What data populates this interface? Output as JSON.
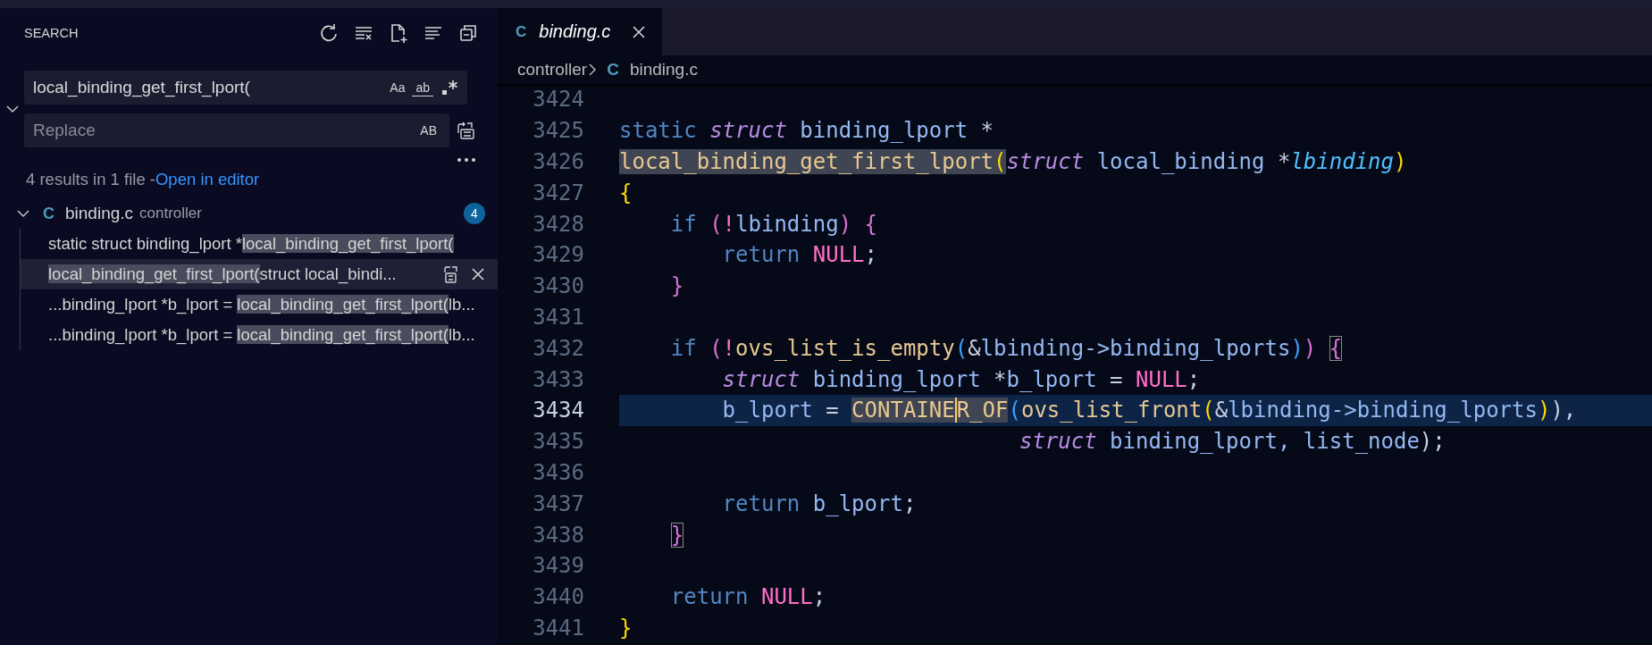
{
  "sidebar": {
    "title": "SEARCH",
    "search": {
      "value": "local_binding_get_first_lport(",
      "case_label": "Aa",
      "word_label": "ab"
    },
    "replace": {
      "expanded": true,
      "placeholder": "Replace",
      "preserve_case_label": "AB"
    },
    "summary": {
      "text": "4 results in 1 file - ",
      "link": "Open in editor"
    },
    "file": {
      "expanded": true,
      "icon_letter": "C",
      "name": "binding.c",
      "folder": "controller",
      "count": "4"
    },
    "results": [
      {
        "before": "static struct binding_lport *",
        "match": "local_binding_get_first_lport(",
        "selected": false
      },
      {
        "match": "local_binding_get_first_lport(",
        "after": "struct local_bindi...",
        "selected": true
      },
      {
        "before": "...binding_lport *b_lport = ",
        "match": "local_binding_get_first_lport(",
        "after": "lb...",
        "selected": false
      },
      {
        "before": "...binding_lport *b_lport = ",
        "match": "local_binding_get_first_lport(",
        "after": "lb...",
        "selected": false
      }
    ]
  },
  "editor": {
    "tab": {
      "icon_letter": "C",
      "label": "binding.c",
      "selected": true
    },
    "breadcrumb": {
      "folder": "controller",
      "icon_letter": "C",
      "file": "binding.c"
    },
    "lines": [
      {
        "number": "3424",
        "current": false
      },
      {
        "number": "3425",
        "current": false,
        "tokens": [
          {
            "text": "static",
            "kind": "keyword"
          },
          {
            "text": " struct",
            "kind": "storage"
          },
          {
            "text": " binding_lport ",
            "kind": "type"
          },
          {
            "text": "*",
            "kind": "op"
          }
        ]
      },
      {
        "number": "3426",
        "current": false,
        "tokens": [
          {
            "text": "local_binding_get_first_lport",
            "kind": "function",
            "highlight": true
          },
          {
            "text": "(",
            "kind": "bracket1",
            "highlight": true
          },
          {
            "text": "struct",
            "kind": "storage"
          },
          {
            "text": " local_binding ",
            "kind": "type"
          },
          {
            "text": "*",
            "kind": "op"
          },
          {
            "text": "lbinding",
            "kind": "param"
          },
          {
            "text": ")",
            "kind": "bracket1"
          }
        ]
      },
      {
        "number": "3427",
        "current": false,
        "tokens": [
          {
            "text": "{",
            "kind": "bracket1"
          }
        ]
      },
      {
        "number": "3428",
        "current": false,
        "tokens": [
          {
            "text": "    if",
            "kind": "keyword"
          },
          {
            "text": " (",
            "kind": "bracket2"
          },
          {
            "text": "!",
            "kind": "null"
          },
          {
            "text": "lbinding",
            "kind": "type"
          },
          {
            "text": ")",
            "kind": "bracket2"
          },
          {
            "text": " {",
            "kind": "bracket2"
          }
        ]
      },
      {
        "number": "3429",
        "current": false,
        "tokens": [
          {
            "text": "        return",
            "kind": "keyword"
          },
          {
            "text": " NULL",
            "kind": "null"
          },
          {
            "text": ";",
            "kind": "op"
          }
        ]
      },
      {
        "number": "3430",
        "current": false,
        "tokens": [
          {
            "text": "    }",
            "kind": "bracket2"
          }
        ]
      },
      {
        "number": "3431",
        "current": false
      },
      {
        "number": "3432",
        "current": false,
        "tokens": [
          {
            "text": "    if",
            "kind": "keyword"
          },
          {
            "text": " (",
            "kind": "bracket2"
          },
          {
            "text": "!",
            "kind": "null"
          },
          {
            "text": "ovs_list_is_empty",
            "kind": "function"
          },
          {
            "text": "(",
            "kind": "bracket3"
          },
          {
            "text": "&",
            "kind": "op"
          },
          {
            "text": "lbinding->binding_lports",
            "kind": "type"
          },
          {
            "text": ")",
            "kind": "bracket3"
          },
          {
            "text": ") ",
            "kind": "bracket2"
          },
          {
            "text": "{",
            "kind": "bracket2",
            "boxed": true
          }
        ]
      },
      {
        "number": "3433",
        "current": false,
        "tokens": [
          {
            "text": "        struct",
            "kind": "storage"
          },
          {
            "text": " binding_lport ",
            "kind": "type"
          },
          {
            "text": "*",
            "kind": "op"
          },
          {
            "text": "b_lport ",
            "kind": "type"
          },
          {
            "text": "=",
            "kind": "op"
          },
          {
            "text": " NULL",
            "kind": "null"
          },
          {
            "text": ";",
            "kind": "op"
          }
        ]
      },
      {
        "number": "3434",
        "current": true,
        "tokens": [
          {
            "text": "        b_lport ",
            "kind": "type"
          },
          {
            "text": "= ",
            "kind": "op"
          },
          {
            "text": "CONTAINE",
            "kind": "function",
            "highlight": true
          },
          {
            "text": "R_OF",
            "kind": "function",
            "highlight": true,
            "cursor": true
          },
          {
            "text": "(",
            "kind": "bracket3"
          },
          {
            "text": "ovs_list_front",
            "kind": "function"
          },
          {
            "text": "(",
            "kind": "bracket1"
          },
          {
            "text": "&",
            "kind": "op"
          },
          {
            "text": "lbinding->binding_lports",
            "kind": "type"
          },
          {
            "text": ")",
            "kind": "bracket1"
          },
          {
            "text": "),",
            "kind": "op"
          }
        ]
      },
      {
        "number": "3435",
        "current": false,
        "tokens": [
          {
            "text": "                               struct",
            "kind": "storage"
          },
          {
            "text": " binding_lport, list_node",
            "kind": "type"
          },
          {
            "text": ");",
            "kind": "op"
          }
        ]
      },
      {
        "number": "3436",
        "current": false
      },
      {
        "number": "3437",
        "current": false,
        "tokens": [
          {
            "text": "        return",
            "kind": "keyword"
          },
          {
            "text": " b_lport",
            "kind": "type"
          },
          {
            "text": ";",
            "kind": "op"
          }
        ]
      },
      {
        "number": "3438",
        "current": false,
        "tokens": [
          {
            "text": "    }",
            "kind": "bracket2",
            "boxed": true
          }
        ]
      },
      {
        "number": "3439",
        "current": false
      },
      {
        "number": "3440",
        "current": false,
        "tokens": [
          {
            "text": "    return",
            "kind": "keyword"
          },
          {
            "text": " NULL",
            "kind": "null"
          },
          {
            "text": ";",
            "kind": "op"
          }
        ]
      },
      {
        "number": "3441",
        "current": false,
        "tokens": [
          {
            "text": "}",
            "kind": "bracket1"
          }
        ]
      }
    ]
  }
}
